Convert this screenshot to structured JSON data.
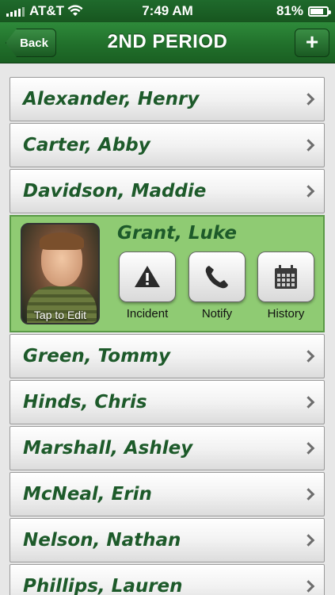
{
  "status_bar": {
    "carrier": "AT&T",
    "time": "7:49 AM",
    "battery": "81%",
    "battery_level": 0.81
  },
  "nav": {
    "title": "2ND PERIOD",
    "back_label": "Back",
    "add_label": "+"
  },
  "students_before": [
    {
      "name": "Alexander, Henry"
    },
    {
      "name": "Carter, Abby"
    },
    {
      "name": "Davidson, Maddie"
    }
  ],
  "expanded_student": {
    "name": "Grant, Luke",
    "photo_caption": "Tap to Edit",
    "actions": [
      {
        "label": "Incident",
        "icon": "warning-icon"
      },
      {
        "label": "Notify",
        "icon": "phone-icon"
      },
      {
        "label": "History",
        "icon": "calendar-icon"
      }
    ]
  },
  "students_after": [
    {
      "name": "Green, Tommy"
    },
    {
      "name": "Hinds, Chris"
    },
    {
      "name": "Marshall, Ashley"
    },
    {
      "name": "McNeal, Erin"
    },
    {
      "name": "Nelson, Nathan"
    },
    {
      "name": "Phillips, Lauren"
    }
  ],
  "colors": {
    "nav_green": "#21702b",
    "name_green": "#1d5a2a",
    "expanded_bg": "#8fcb73"
  }
}
